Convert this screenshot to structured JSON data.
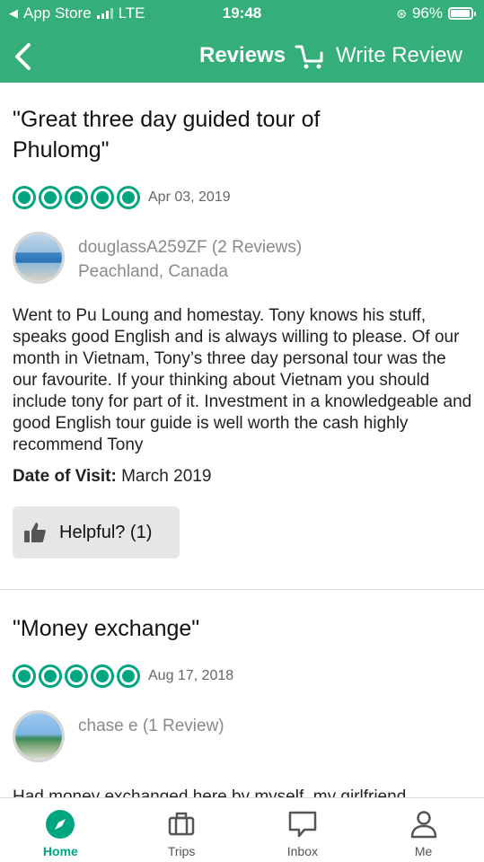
{
  "status_bar": {
    "carrier_back": "App Store",
    "network": "LTE",
    "time": "19:48",
    "battery": "96%",
    "battery_level": 0.96
  },
  "nav": {
    "title": "Reviews",
    "write_review": "Write Review",
    "icons": [
      "chevron-left-icon",
      "cart-icon"
    ]
  },
  "reviews": [
    {
      "title": "\"Great three day guided tour of Phulomg\"",
      "rating": 5,
      "date": "Apr 03, 2019",
      "author": "douglassA259ZF (2 Reviews)",
      "location": "Peachland, Canada",
      "body": "Went to Pu Loung and homestay. Tony knows his stuff, speaks good English and is always willing to please. Of our month in Vietnam, Tony’s three day personal tour was the our favourite. If your thinking about Vietnam you should include tony for part of it. Investment in a knowledgeable and good English tour guide is well worth the cash highly recommend Tony",
      "visit_label": "Date of Visit:",
      "visit_value": "March 2019",
      "helpful": "Helpful? (1)"
    },
    {
      "title": "\"Money exchange\"",
      "rating": 5,
      "date": "Aug 17, 2018",
      "author": "chase e (1 Review)",
      "body": "Had money exchanged here by myself, my girlfriend"
    }
  ],
  "tabs": [
    {
      "label": "Home",
      "icon": "compass-icon",
      "active": true
    },
    {
      "label": "Trips",
      "icon": "suitcase-icon",
      "active": false
    },
    {
      "label": "Inbox",
      "icon": "message-icon",
      "active": false
    },
    {
      "label": "Me",
      "icon": "person-icon",
      "active": false
    }
  ],
  "colors": {
    "header_green": "#34af7a",
    "rating_green": "#00a680"
  }
}
